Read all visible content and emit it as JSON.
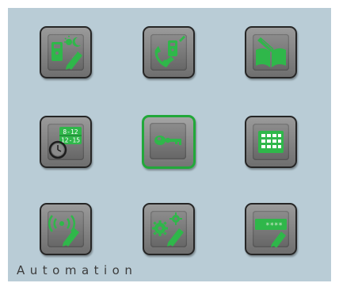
{
  "screen_label": "Automation",
  "tiles": [
    {
      "icon": "intercom-day-night-icon"
    },
    {
      "icon": "phone-intercom-icon"
    },
    {
      "icon": "book-pencil-icon"
    },
    {
      "icon": "time-schedule-icon",
      "schedule_line1": "8-12",
      "schedule_line2": "12-15"
    },
    {
      "icon": "key-icon",
      "selected": true
    },
    {
      "icon": "keypad-grid-icon"
    },
    {
      "icon": "wireless-signal-icon"
    },
    {
      "icon": "gear-settings-icon"
    },
    {
      "icon": "password-card-icon",
      "password_mask": "****"
    }
  ],
  "colors": {
    "background": "#b9ccd6",
    "accent": "#22a83a",
    "icon_green": "#2fb74a",
    "tile_border": "#262626",
    "label": "#3c3c3c"
  }
}
